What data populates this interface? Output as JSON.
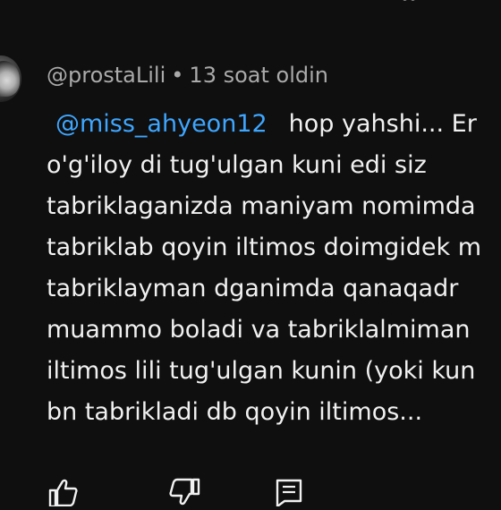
{
  "comment": {
    "author": "@prostaLili",
    "separator": "•",
    "time": "13 soat oldin",
    "mention": "@miss_ahyeon12",
    "first_line_rest": "hop yahshi... Er",
    "lines": [
      "o'g'iloy di tug'ulgan kuni edi siz",
      "tabriklaganizda maniyam nomimda",
      "tabriklab qoyin iltimos doimgidek m",
      "tabriklayman dganimda qanaqadr",
      "muammo boladi va tabriklalmiman",
      "iltimos lili tug'ulgan kunin (yoki kun",
      "bn tabrikladi db qoyin iltimos..."
    ]
  },
  "icons": {
    "like": "thumbs-up-icon",
    "dislike": "thumbs-down-icon",
    "reply": "reply-comment-icon"
  },
  "colors": {
    "background": "#0f0f0f",
    "text": "#f1f1f1",
    "meta": "#aaaaaa",
    "mention": "#3ea6ff"
  }
}
